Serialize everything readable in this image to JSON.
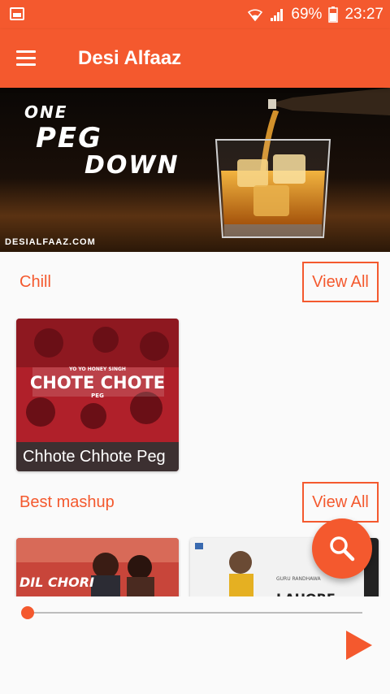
{
  "status_bar": {
    "battery_percent": "69%",
    "time": "23:27",
    "icons": [
      "notification-icon",
      "wifi-icon",
      "signal-icon",
      "battery-icon"
    ]
  },
  "app_bar": {
    "title": "Desi Alfaaz",
    "menu_icon": "menu-icon"
  },
  "banner": {
    "line1": "ONE",
    "line2": "PEG",
    "line3": "DOWN",
    "site": "DESIALFAAZ.COM"
  },
  "sections": [
    {
      "title": "Chill",
      "view_all": "View All",
      "cards": [
        {
          "caption": "Chhote Chhote Peg",
          "art_text": "CHOTE CHOTE",
          "art_sub": "PEG",
          "art_top": "YO YO HONEY SINGH"
        }
      ]
    },
    {
      "title": "Best mashup",
      "view_all": "View All",
      "cards": [
        {
          "caption": "",
          "art_text": "DIL CHORI"
        },
        {
          "caption": "",
          "art_text": "LAHORE",
          "art_top": "GURU RANDHAWA"
        }
      ]
    }
  ],
  "fab": {
    "icon": "search-icon"
  },
  "player": {
    "progress": 0.0,
    "play_icon": "play-icon"
  },
  "colors": {
    "accent": "#f4592e",
    "background": "#fafafa"
  }
}
